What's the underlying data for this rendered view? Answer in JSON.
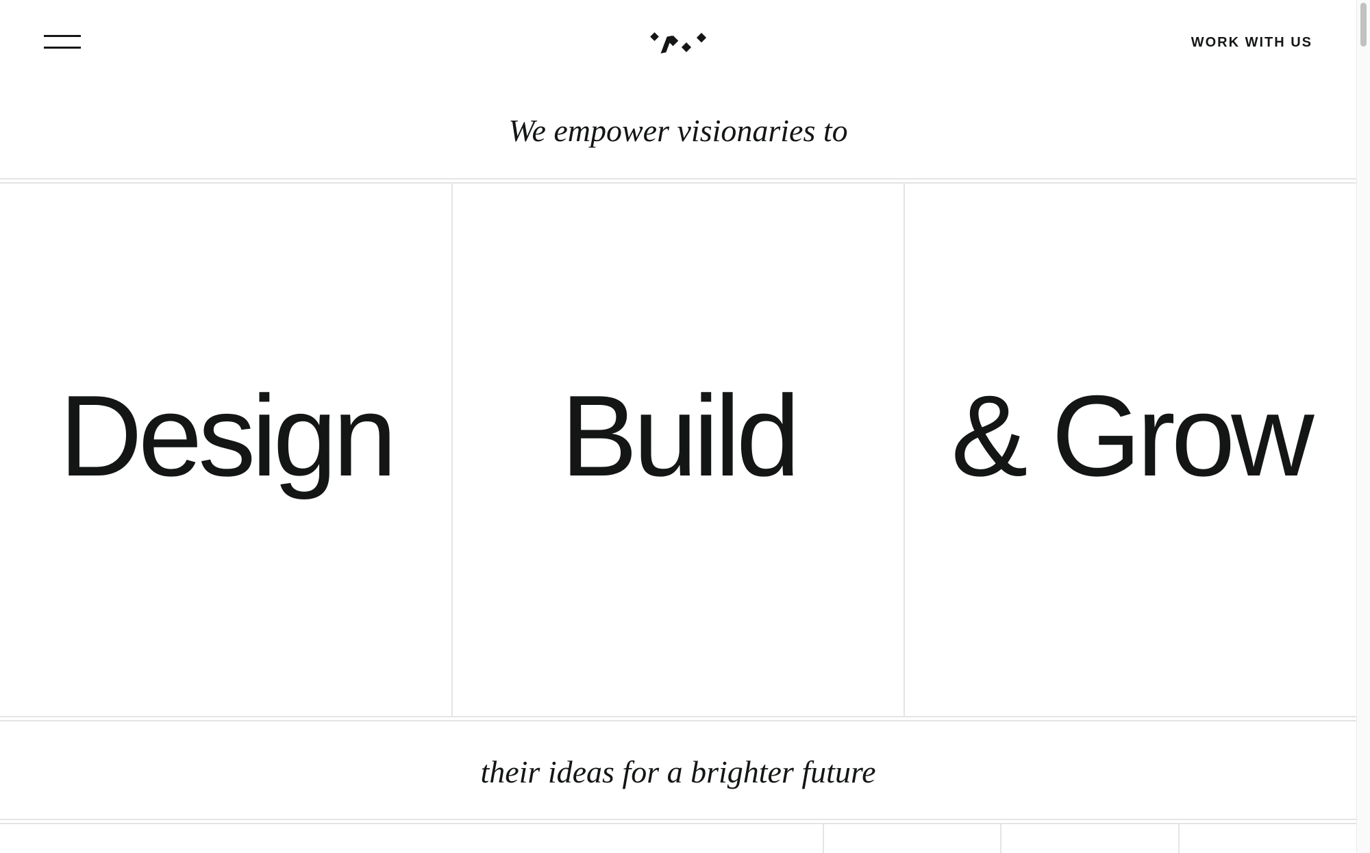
{
  "header": {
    "menu_label": "Menu",
    "logo_name": "brand-logo",
    "cta_label": "WORK WITH US"
  },
  "hero": {
    "intro": "We empower visionaries to",
    "words": [
      "Design",
      "Build",
      "& Grow"
    ],
    "outro": "their ideas for a brighter future"
  },
  "colors": {
    "text": "#141616",
    "background": "#ffffff",
    "divider": "#e4e4e4"
  }
}
